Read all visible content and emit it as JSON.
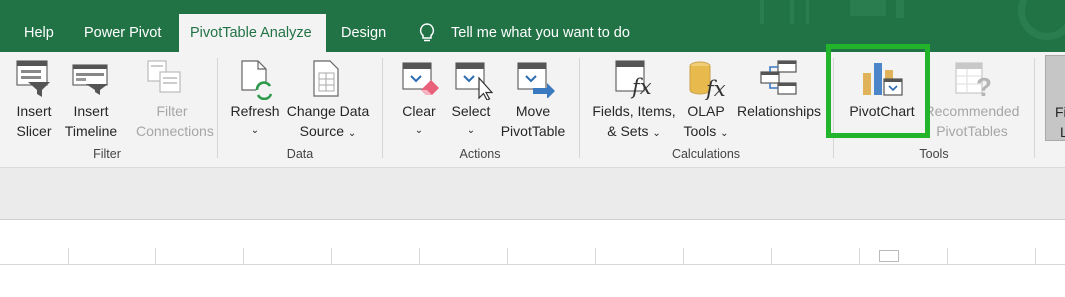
{
  "tabs": {
    "help": "Help",
    "power_pivot": "Power Pivot",
    "pivottable_analyze": "PivotTable Analyze",
    "design": "Design",
    "tell_me": "Tell me what you want to do"
  },
  "filter": {
    "insert_slicer": [
      "Insert",
      "Slicer"
    ],
    "insert_timeline": [
      "Insert",
      "Timeline"
    ],
    "filter_connections": [
      "Filter",
      "Connections"
    ],
    "group": "Filter"
  },
  "data": {
    "refresh": "Refresh",
    "change_data_source": [
      "Change Data",
      "Source"
    ],
    "group": "Data"
  },
  "actions": {
    "clear": "Clear",
    "select": "Select",
    "move_pivottable": [
      "Move",
      "PivotTable"
    ],
    "group": "Actions"
  },
  "calculations": {
    "fields_items_sets": [
      "Fields, Items,",
      "& Sets"
    ],
    "olap_tools": [
      "OLAP",
      "Tools"
    ],
    "relationships": "Relationships",
    "group": "Calculations"
  },
  "tools": {
    "pivotchart": "PivotChart",
    "recommended_pivottables": [
      "Recommended",
      "PivotTables"
    ],
    "group": "Tools"
  },
  "partial": {
    "line1": "Fi",
    "line2": "L"
  },
  "colors": {
    "tab_green": "#217346",
    "highlight_green": "#22b42a",
    "ribbon_bg": "#f3f3f3",
    "disabled_text": "#a6a6a6"
  }
}
